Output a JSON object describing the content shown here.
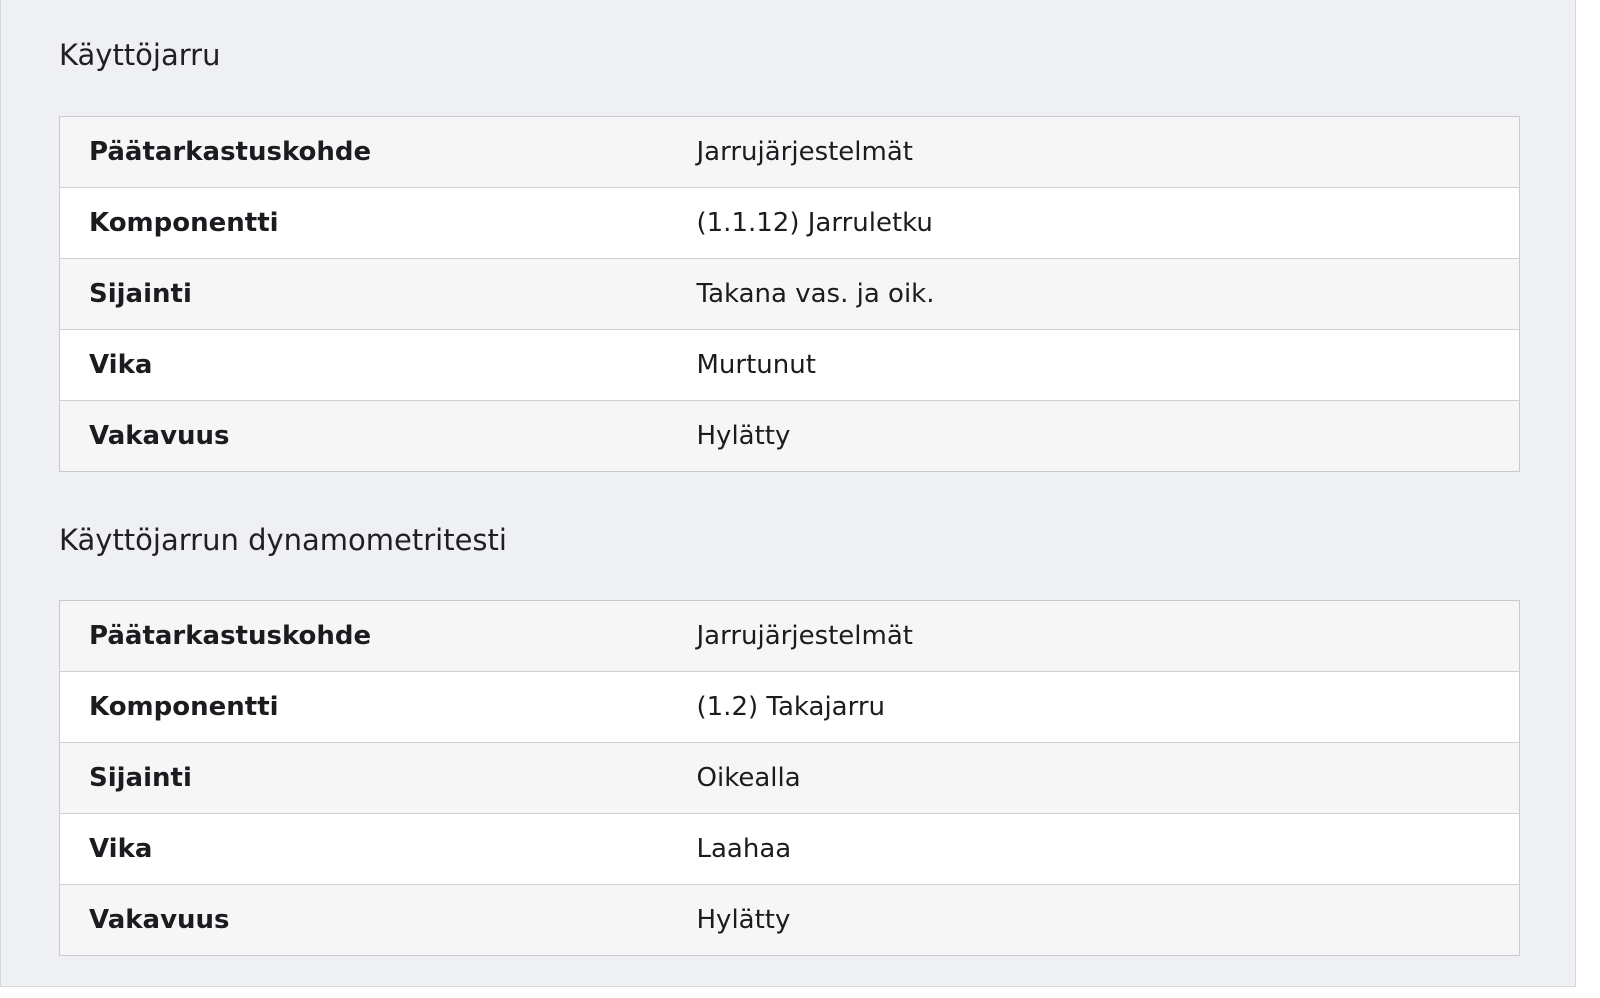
{
  "sections": [
    {
      "title": "Käyttöjarru",
      "rows": [
        {
          "label": "Päätarkastuskohde",
          "value": "Jarrujärjestelmät"
        },
        {
          "label": "Komponentti",
          "value": "(1.1.12) Jarruletku"
        },
        {
          "label": "Sijainti",
          "value": "Takana vas. ja oik."
        },
        {
          "label": "Vika",
          "value": "Murtunut"
        },
        {
          "label": "Vakavuus",
          "value": "Hylätty"
        }
      ]
    },
    {
      "title": "Käyttöjarrun dynamometritesti",
      "rows": [
        {
          "label": "Päätarkastuskohde",
          "value": "Jarrujärjestelmät"
        },
        {
          "label": "Komponentti",
          "value": "(1.2) Takajarru"
        },
        {
          "label": "Sijainti",
          "value": "Oikealla"
        },
        {
          "label": "Vika",
          "value": "Laahaa"
        },
        {
          "label": "Vakavuus",
          "value": "Hylätty"
        }
      ]
    }
  ]
}
